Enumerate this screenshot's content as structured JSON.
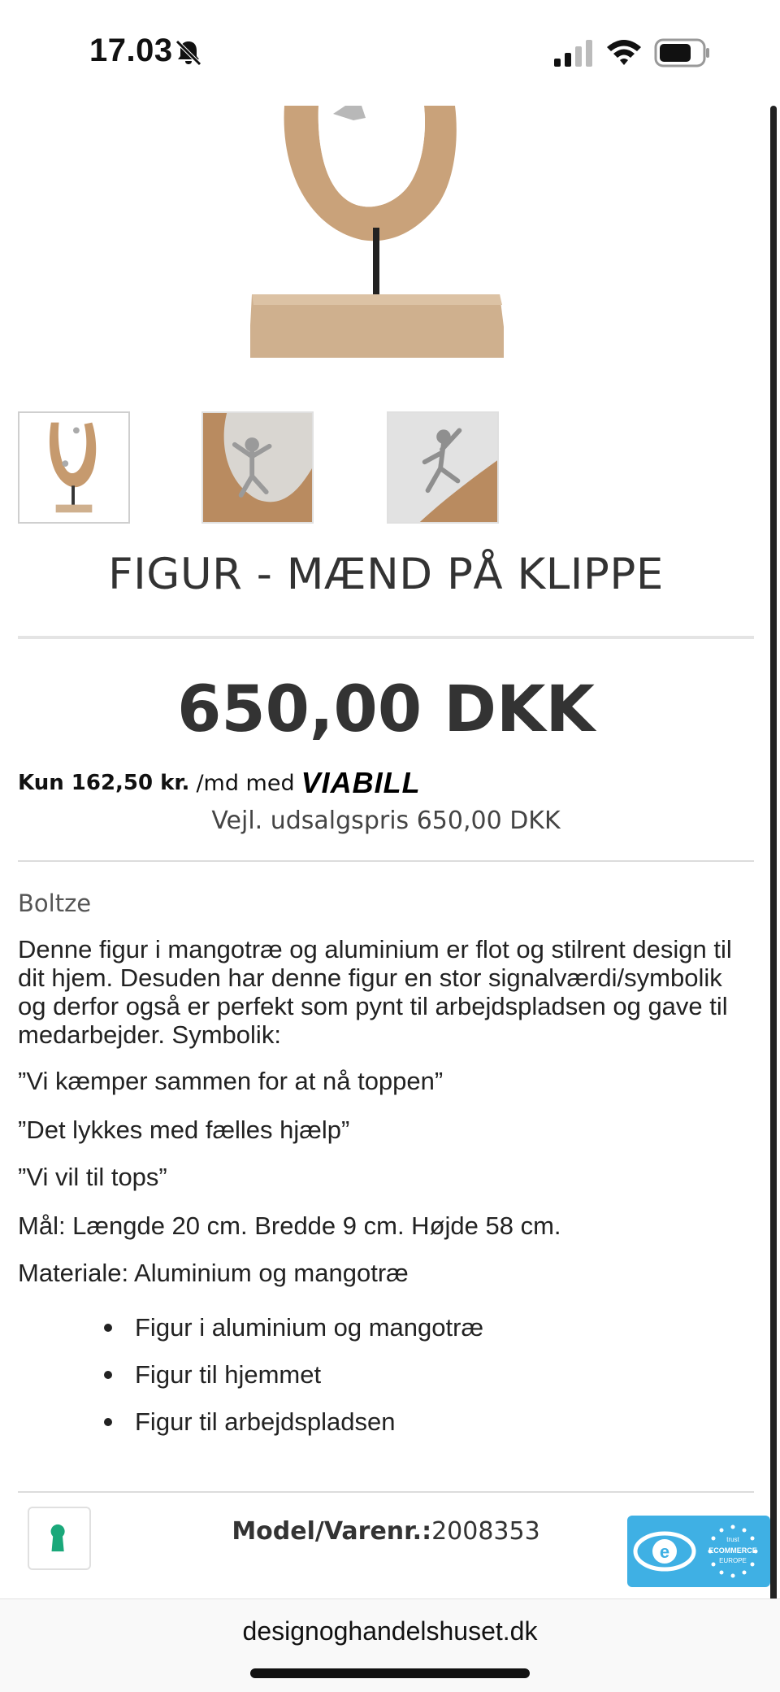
{
  "status_bar": {
    "time": "17.03",
    "icons": [
      "bell-slash-icon",
      "cellular-signal-icon",
      "wifi-icon",
      "battery-icon"
    ]
  },
  "product": {
    "title": "FIGUR - MÆND PÅ KLIPPE",
    "price": "650,00 DKK",
    "financing": {
      "amount": "Kun 162,50 kr.",
      "suffix": "/md med",
      "provider": "VIABILL"
    },
    "suggested_price": "Vejl. udsalgspris 650,00 DKK",
    "brand": "Boltze",
    "description": "Denne figur i mangotræ og aluminium er flot og stilrent design til dit hjem. Desuden har denne figur en stor signalværdi/symbolik og derfor også er perfekt som pynt til arbejdspladsen og gave til medarbejder.  Symbolik:",
    "quotes": [
      "”Vi kæmper sammen for at nå toppen”",
      "”Det lykkes med fælles hjælp”",
      "”Vi vil til tops”"
    ],
    "dimensions": "Mål: Længde 20 cm. Bredde 9 cm. Højde 58 cm.",
    "material": "Materiale: Aluminium og mangotræ",
    "features": [
      "Figur i aluminium og mangotræ",
      "Figur til hjemmet",
      "Figur til arbejdspladsen"
    ],
    "model": {
      "label": "Model/Varenr.:",
      "value": "2008353"
    }
  },
  "trust_badge": {
    "line1": "trust",
    "line2": "ECOMMERCE",
    "line3": "EUROPE"
  },
  "browser": {
    "url": "designoghandelshuset.dk"
  },
  "colors": {
    "accent_green": "#1aa87a",
    "trust_blue": "#3fb0e4"
  }
}
